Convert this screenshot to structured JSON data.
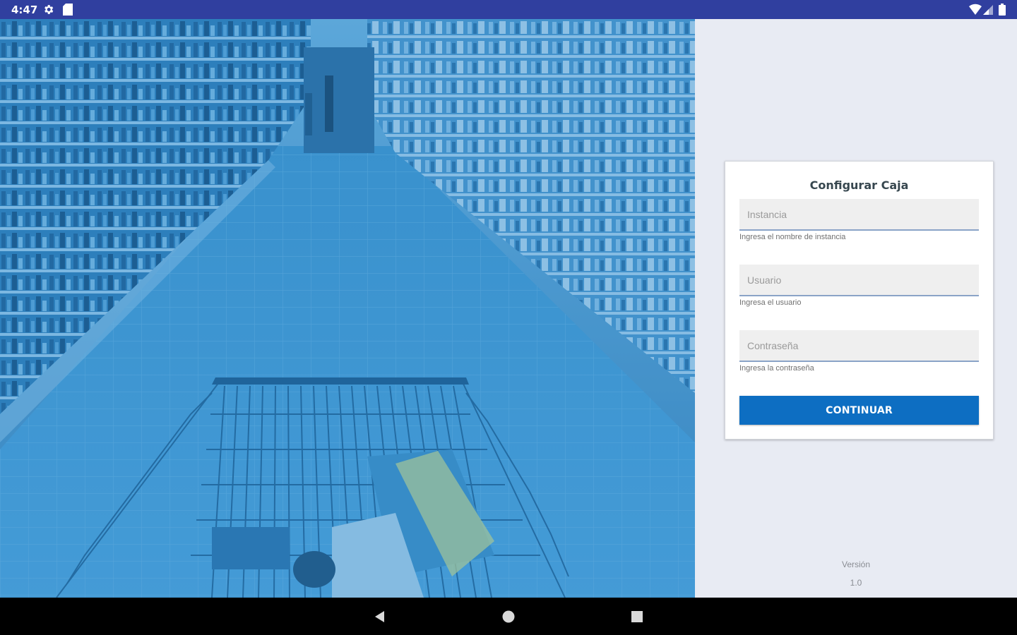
{
  "status_bar": {
    "time": "4:47",
    "icons": [
      "gear-icon",
      "sd-card-icon",
      "wifi-icon",
      "cellular-signal-icon",
      "battery-icon"
    ]
  },
  "hero": {
    "description_icon": "supermarket-aisle-cart-image"
  },
  "form": {
    "title": "Configurar Caja",
    "instancia": {
      "placeholder": "Instancia",
      "value": "",
      "helper": "Ingresa el nombre de instancia"
    },
    "usuario": {
      "placeholder": "Usuario",
      "value": "",
      "helper": "Ingresa el usuario"
    },
    "contrasena": {
      "placeholder": "Contraseña",
      "value": "",
      "helper": "Ingresa la contraseña"
    },
    "continue_label": "CONTINUAR"
  },
  "footer": {
    "version_label": "Versión",
    "version_value": "1.0"
  },
  "nav_bar": {
    "icons": [
      "back-icon",
      "home-icon",
      "recents-icon"
    ]
  },
  "colors": {
    "status_bar": "#303f9f",
    "hero_tint": "#3d93cc",
    "panel_bg": "#e8ebf3",
    "button": "#0d6ec2",
    "field_underline": "#8aa3c7"
  }
}
